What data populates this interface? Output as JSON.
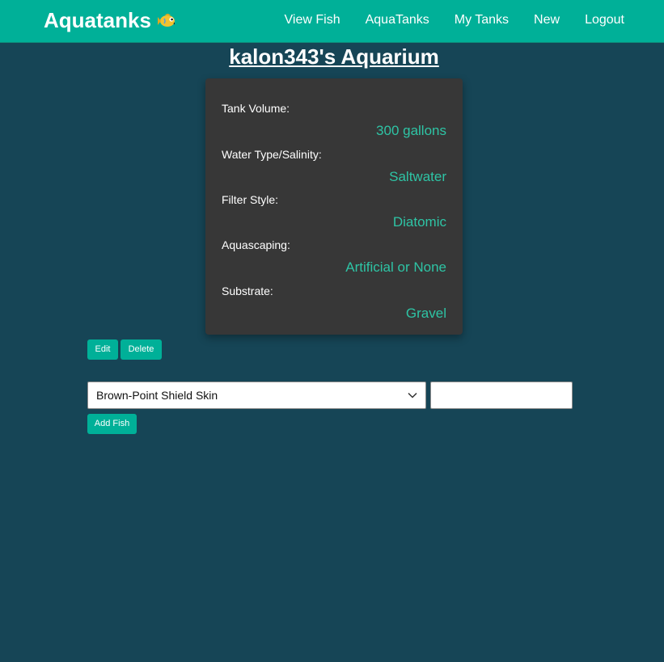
{
  "navbar": {
    "brand": "Aquatanks",
    "brand_icon": "fish-icon",
    "links": [
      "View Fish",
      "AquaTanks",
      "My Tanks",
      "New",
      "Logout"
    ]
  },
  "page": {
    "title": "kalon343's Aquarium"
  },
  "tank": {
    "fields": [
      {
        "label": "Tank Volume:",
        "value": "300 gallons"
      },
      {
        "label": "Water Type/Salinity:",
        "value": "Saltwater"
      },
      {
        "label": "Filter Style:",
        "value": "Diatomic"
      },
      {
        "label": "Aquascaping:",
        "value": "Artificial or None"
      },
      {
        "label": "Substrate:",
        "value": "Gravel"
      }
    ]
  },
  "actions": {
    "edit_label": "Edit",
    "delete_label": "Delete"
  },
  "add_fish": {
    "selected_fish": "Brown-Point Shield Skin",
    "quantity_value": "",
    "button_label": "Add Fish"
  },
  "colors": {
    "navbar": "#00b098",
    "background": "#164556",
    "card": "#373737",
    "accent_text": "#2ec4a5",
    "button": "#00b098"
  }
}
